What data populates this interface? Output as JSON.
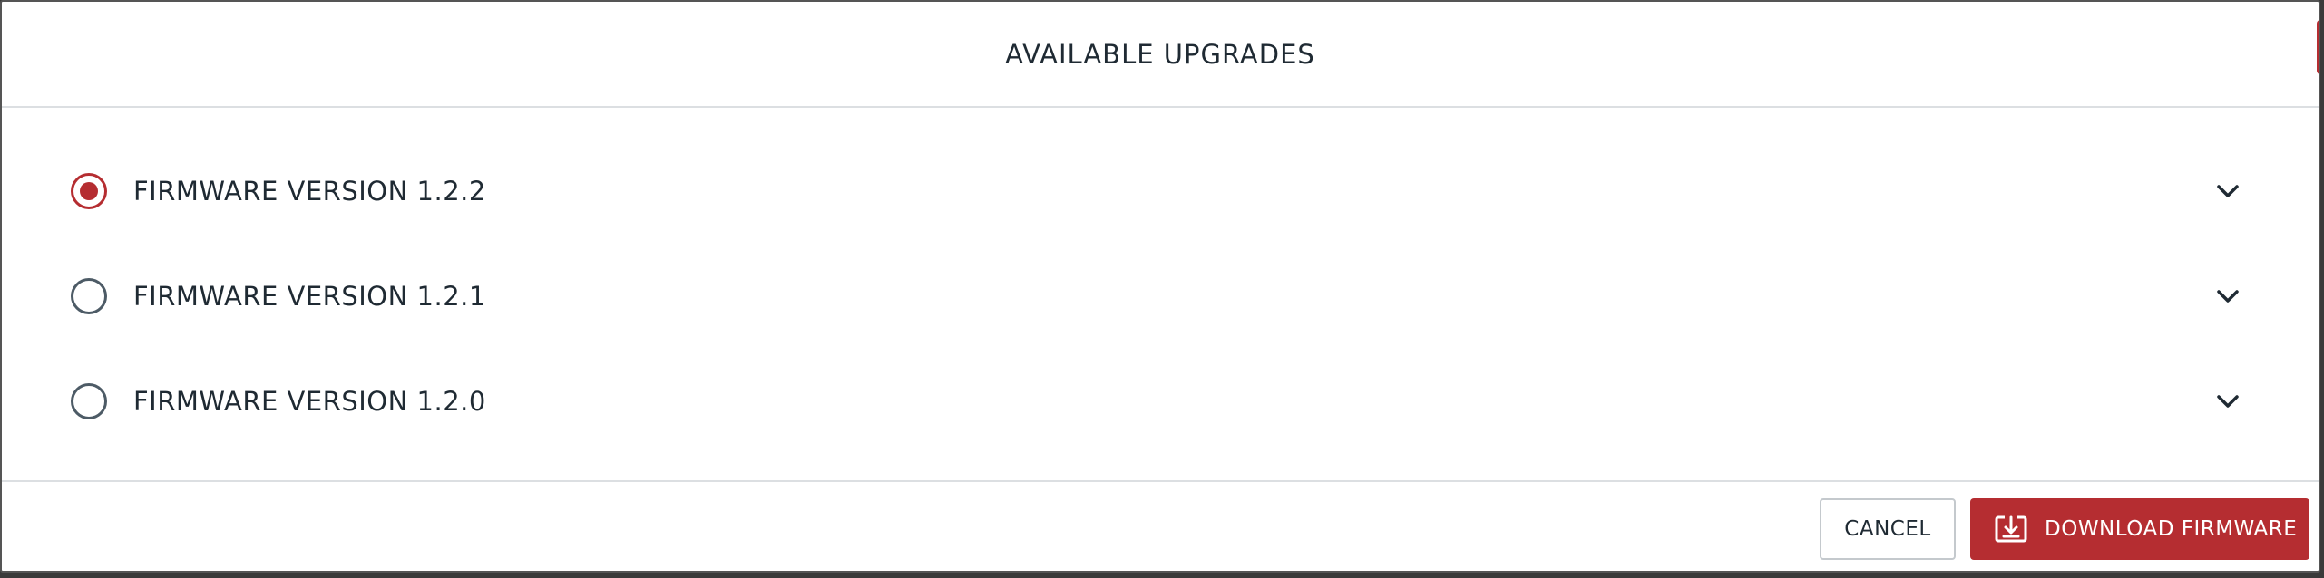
{
  "dialog": {
    "title": "AVAILABLE UPGRADES"
  },
  "options": [
    {
      "label": "FIRMWARE VERSION 1.2.2",
      "selected": true,
      "expand_icon": "chevron-down-icon"
    },
    {
      "label": "FIRMWARE VERSION 1.2.1",
      "selected": false,
      "expand_icon": "chevron-down-icon"
    },
    {
      "label": "FIRMWARE VERSION 1.2.0",
      "selected": false,
      "expand_icon": "chevron-down-icon"
    }
  ],
  "footer": {
    "cancel_label": "CANCEL",
    "download_label": "DOWNLOAD FIRMWARE",
    "download_icon": "download-icon"
  },
  "colors": {
    "accent": "#b52d31",
    "radio_unchecked": "#4d5b66",
    "text": "#1f2a33",
    "divider": "#dcdfe2"
  }
}
